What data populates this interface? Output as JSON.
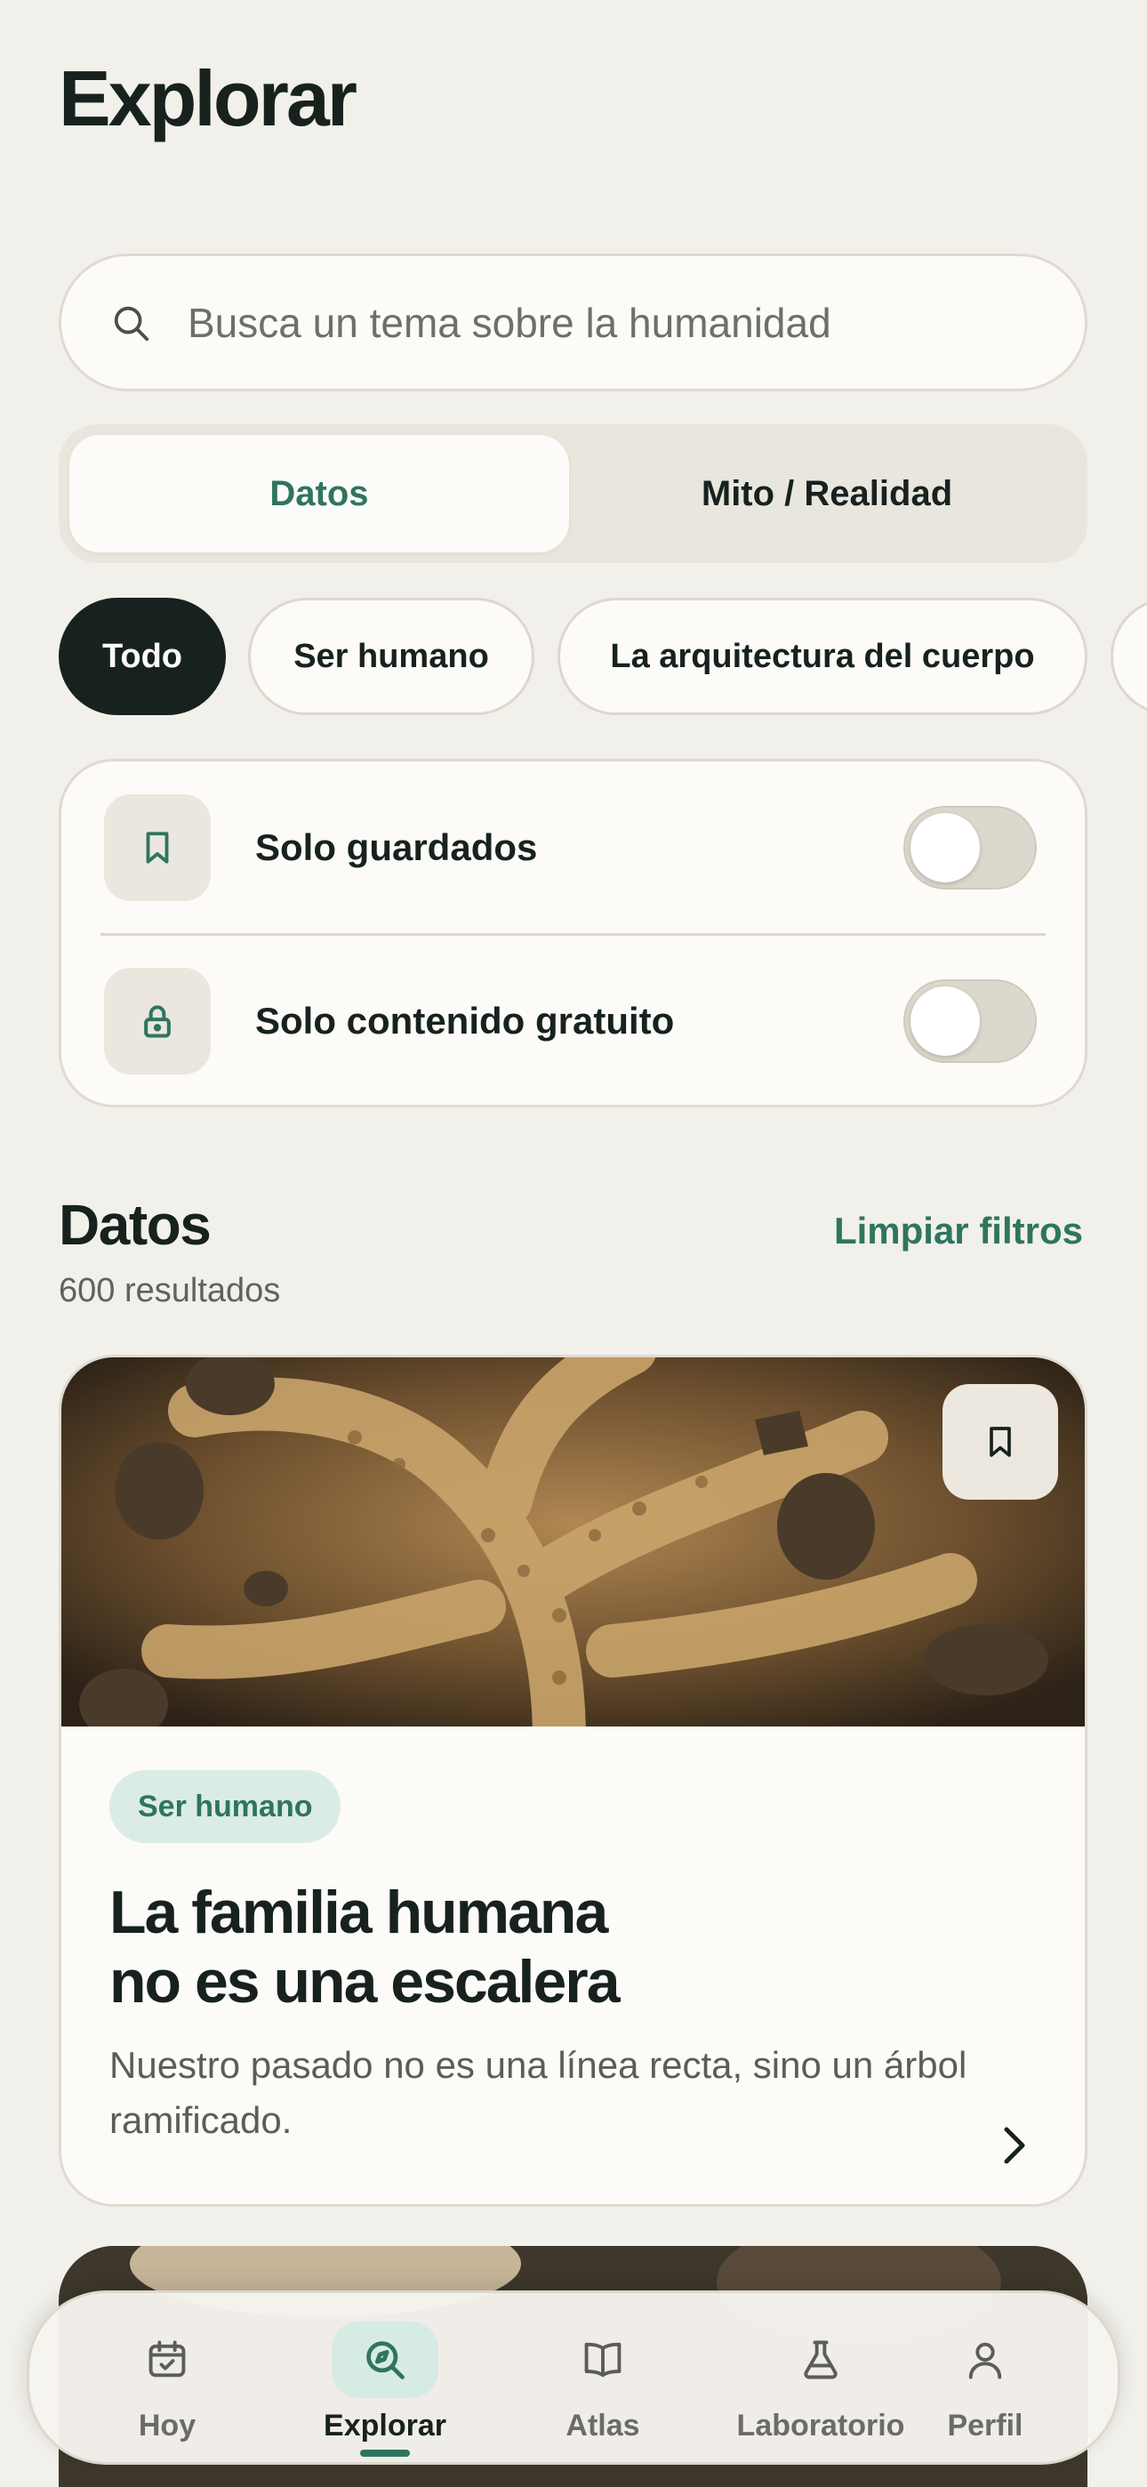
{
  "header": {
    "title": "Explorar"
  },
  "search": {
    "placeholder": "Busca un tema sobre la humanidad",
    "icon": "search-icon"
  },
  "segment": {
    "items": [
      "Datos",
      "Mito / Realidad"
    ],
    "selected": "Datos"
  },
  "chips": {
    "items": [
      "Todo",
      "Ser humano",
      "La arquitectura del cuerpo"
    ],
    "selected": "Todo"
  },
  "filters": {
    "saved_only": {
      "label": "Solo guardados",
      "icon": "bookmark-icon",
      "on": false
    },
    "free_only": {
      "label": "Solo contenido gratuito",
      "icon": "lock-icon",
      "on": false
    }
  },
  "results": {
    "title": "Datos",
    "count": "600 resultados",
    "clear_label": "Limpiar filtros"
  },
  "card": {
    "tag": "Ser humano",
    "title_line1": "La familia humana",
    "title_line2": "no es una escalera",
    "description": "Nuestro pasado no es una línea recta, sino un árbol ramificado."
  },
  "tabbar": {
    "items": [
      {
        "label": "Hoy",
        "icon": "calendar-check-icon"
      },
      {
        "label": "Explorar",
        "icon": "explore-search-icon"
      },
      {
        "label": "Atlas",
        "icon": "book-open-icon"
      },
      {
        "label": "Laboratorio",
        "icon": "flask-icon"
      },
      {
        "label": "Perfil",
        "icon": "person-icon"
      }
    ],
    "active": "Explorar"
  },
  "colors": {
    "background": "#f2f0ea",
    "accent": "#2e7560",
    "dark": "#17221f",
    "tag_bg": "#dbece6"
  }
}
